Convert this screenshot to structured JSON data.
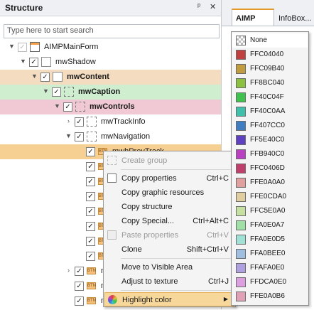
{
  "panel": {
    "title": "Structure",
    "pin": "ᵖ",
    "close": "✕",
    "search_placeholder": "Type here to start search"
  },
  "tree": [
    {
      "label": "AIMPMainForm",
      "indent": 0,
      "exp": "▼",
      "checked": true,
      "icon": "form",
      "bold": false,
      "bg": ""
    },
    {
      "label": "mwShadow",
      "indent": 1,
      "exp": "▼",
      "checked": true,
      "icon": "frame",
      "bold": false,
      "bg": ""
    },
    {
      "label": "mwContent",
      "indent": 2,
      "exp": "▼",
      "checked": true,
      "icon": "frame",
      "bold": true,
      "bg": "#f4dcc0"
    },
    {
      "label": "mwCaption",
      "indent": 3,
      "exp": "▼",
      "checked": true,
      "icon": "dash",
      "bold": true,
      "bg": "#cfeecf"
    },
    {
      "label": "mwControls",
      "indent": 4,
      "exp": "▼",
      "checked": true,
      "icon": "dash",
      "bold": true,
      "bg": "#f1c9d4"
    },
    {
      "label": "mwTrackInfo",
      "indent": 5,
      "exp": "›",
      "checked": true,
      "icon": "dash",
      "bold": false,
      "bg": ""
    },
    {
      "label": "mwNavigation",
      "indent": 5,
      "exp": "▼",
      "checked": true,
      "icon": "dash",
      "bold": false,
      "bg": ""
    },
    {
      "label": "mwbPrevTrack",
      "indent": 6,
      "exp": "",
      "checked": true,
      "icon": "btn",
      "bold": false,
      "bg": "#f6cf93"
    },
    {
      "label": "",
      "indent": 6,
      "exp": "",
      "checked": true,
      "icon": "btn",
      "bold": false,
      "bg": ""
    },
    {
      "label": "",
      "indent": 6,
      "exp": "",
      "checked": true,
      "icon": "btn",
      "bold": false,
      "bg": ""
    },
    {
      "label": "",
      "indent": 6,
      "exp": "",
      "checked": true,
      "icon": "btn",
      "bold": false,
      "bg": ""
    },
    {
      "label": "",
      "indent": 6,
      "exp": "",
      "checked": true,
      "icon": "btn",
      "bold": false,
      "bg": ""
    },
    {
      "label": "",
      "indent": 6,
      "exp": "",
      "checked": true,
      "icon": "btn",
      "bold": false,
      "bg": ""
    },
    {
      "label": "",
      "indent": 6,
      "exp": "",
      "checked": true,
      "icon": "btn",
      "bold": false,
      "bg": ""
    },
    {
      "label": "",
      "indent": 6,
      "exp": "",
      "checked": true,
      "icon": "btn",
      "bold": false,
      "bg": ""
    },
    {
      "label": "m",
      "indent": 5,
      "exp": "›",
      "checked": true,
      "icon": "btn",
      "bold": false,
      "bg": ""
    },
    {
      "label": "m",
      "indent": 5,
      "exp": "",
      "checked": true,
      "icon": "btn",
      "bold": false,
      "bg": ""
    },
    {
      "label": "m",
      "indent": 5,
      "exp": "",
      "checked": true,
      "icon": "btn",
      "bold": false,
      "bg": ""
    }
  ],
  "menu": [
    {
      "label": "Create group",
      "shortcut": "",
      "disabled": true,
      "icon": "group"
    },
    {
      "sep": true
    },
    {
      "label": "Copy properties",
      "shortcut": "Ctrl+C",
      "disabled": false,
      "icon": "copy"
    },
    {
      "label": "Copy graphic resources",
      "shortcut": "",
      "disabled": false,
      "icon": ""
    },
    {
      "label": "Copy structure",
      "shortcut": "",
      "disabled": false,
      "icon": ""
    },
    {
      "label": "Copy Special...",
      "shortcut": "Ctrl+Alt+C",
      "disabled": false,
      "icon": ""
    },
    {
      "label": "Paste properties",
      "shortcut": "Ctrl+V",
      "disabled": true,
      "icon": "paste"
    },
    {
      "label": "Clone",
      "shortcut": "Shift+Ctrl+V",
      "disabled": false,
      "icon": ""
    },
    {
      "sep": true
    },
    {
      "label": "Move to Visible Area",
      "shortcut": "",
      "disabled": false,
      "icon": ""
    },
    {
      "label": "Adjust to texture",
      "shortcut": "Ctrl+J",
      "disabled": false,
      "icon": ""
    },
    {
      "sep": true
    },
    {
      "label": "Highlight color",
      "shortcut": "",
      "disabled": false,
      "icon": "palette",
      "highlight": true,
      "submenu": true
    }
  ],
  "tabs": [
    {
      "label": "AIMP",
      "active": true
    },
    {
      "label": "InfoBox...",
      "active": false
    }
  ],
  "colors": [
    {
      "name": "None",
      "hex": "none"
    },
    {
      "name": "FFC04040",
      "hex": "#c04040"
    },
    {
      "name": "FFC09B40",
      "hex": "#c09b40"
    },
    {
      "name": "FF8BC040",
      "hex": "#8bc040"
    },
    {
      "name": "FF40C04F",
      "hex": "#40c04f"
    },
    {
      "name": "FF40C0AA",
      "hex": "#40c0aa"
    },
    {
      "name": "FF407CC0",
      "hex": "#407cc0"
    },
    {
      "name": "FF5E40C0",
      "hex": "#5e40c0"
    },
    {
      "name": "FFB940C0",
      "hex": "#b940c0"
    },
    {
      "name": "FFC0406D",
      "hex": "#c0406d"
    },
    {
      "name": "FFE0A0A0",
      "hex": "#e0a0a0"
    },
    {
      "name": "FFE0CDA0",
      "hex": "#e0cda0"
    },
    {
      "name": "FFC5E0A0",
      "hex": "#c5e0a0"
    },
    {
      "name": "FFA0E0A7",
      "hex": "#a0e0a7"
    },
    {
      "name": "FFA0E0D5",
      "hex": "#a0e0d5"
    },
    {
      "name": "FFA0BEE0",
      "hex": "#a0bee0"
    },
    {
      "name": "FFAFA0E0",
      "hex": "#afa0e0"
    },
    {
      "name": "FFDCA0E0",
      "hex": "#dca0e0"
    },
    {
      "name": "FFE0A0B6",
      "hex": "#e0a0b6"
    }
  ]
}
